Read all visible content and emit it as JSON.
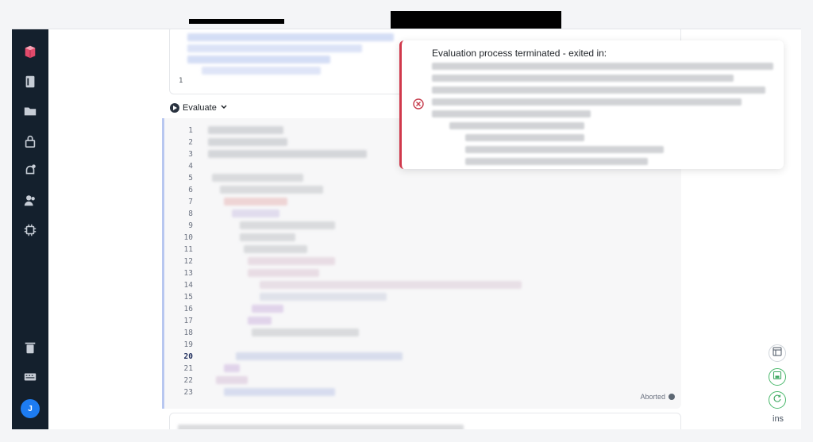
{
  "sidebar": {
    "items": [
      {
        "name": "logo",
        "icon": "logo-icon"
      },
      {
        "name": "notebooks",
        "icon": "notebook-icon"
      },
      {
        "name": "files",
        "icon": "folder-icon"
      },
      {
        "name": "secrets",
        "icon": "lock-icon"
      },
      {
        "name": "alerts",
        "icon": "bell-icon"
      },
      {
        "name": "users",
        "icon": "users-icon"
      },
      {
        "name": "compute",
        "icon": "chip-icon"
      },
      {
        "name": "trash",
        "icon": "trash-icon"
      },
      {
        "name": "keyboard",
        "icon": "keyboard-icon"
      }
    ],
    "avatar_initial": "J",
    "avatar_color": "#1d7cf2"
  },
  "cell_above": {
    "line_number": "1"
  },
  "cell": {
    "run_label": "Evaluate",
    "line_numbers": [
      "1",
      "2",
      "3",
      "4",
      "5",
      "6",
      "7",
      "8",
      "9",
      "10",
      "11",
      "12",
      "13",
      "14",
      "15",
      "16",
      "17",
      "18",
      "19",
      "20",
      "21",
      "22",
      "23"
    ],
    "active_line": "20",
    "status": "Aborted"
  },
  "toast": {
    "title": "Evaluation process terminated - exited in:",
    "accent_color": "#d0384b"
  },
  "right_tools": {
    "tools": [
      "layout-icon",
      "save-icon",
      "refresh-icon"
    ],
    "mode_label": "ins"
  }
}
